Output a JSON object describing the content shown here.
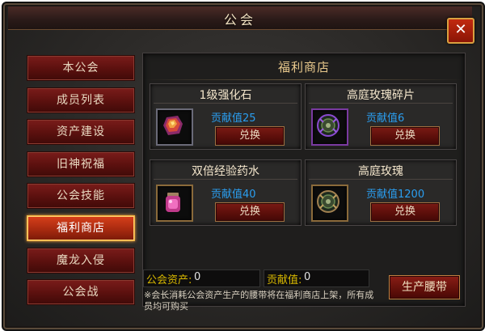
{
  "window": {
    "title": "公会",
    "close_label": "✕"
  },
  "sidebar": {
    "items": [
      {
        "label": "本公会"
      },
      {
        "label": "成员列表"
      },
      {
        "label": "资产建设"
      },
      {
        "label": "旧神祝福"
      },
      {
        "label": "公会技能"
      },
      {
        "label": "福利商店",
        "active": true
      },
      {
        "label": "魔龙入侵"
      },
      {
        "label": "公会战"
      }
    ]
  },
  "shop": {
    "title": "福利商店",
    "items": [
      {
        "name": "1级强化石",
        "value": "贡献值25",
        "button": "兑换",
        "icon": "enhancement-stone-icon"
      },
      {
        "name": "高庭玫瑰碎片",
        "value": "贡献值6",
        "button": "兑换",
        "icon": "rose-fragment-icon"
      },
      {
        "name": "双倍经验药水",
        "value": "贡献值40",
        "button": "兑换",
        "icon": "exp-potion-icon"
      },
      {
        "name": "高庭玫瑰",
        "value": "贡献值1200",
        "button": "兑换",
        "icon": "rose-icon"
      }
    ]
  },
  "footer": {
    "assets_label": "公会资产:",
    "assets_value": "0",
    "contribution_label": "贡献值:",
    "contribution_value": "0",
    "produce_button": "生产腰带",
    "note": "※会长消耗公会资产生产的腰带将在福利商店上架，所有成员均可购买"
  }
}
